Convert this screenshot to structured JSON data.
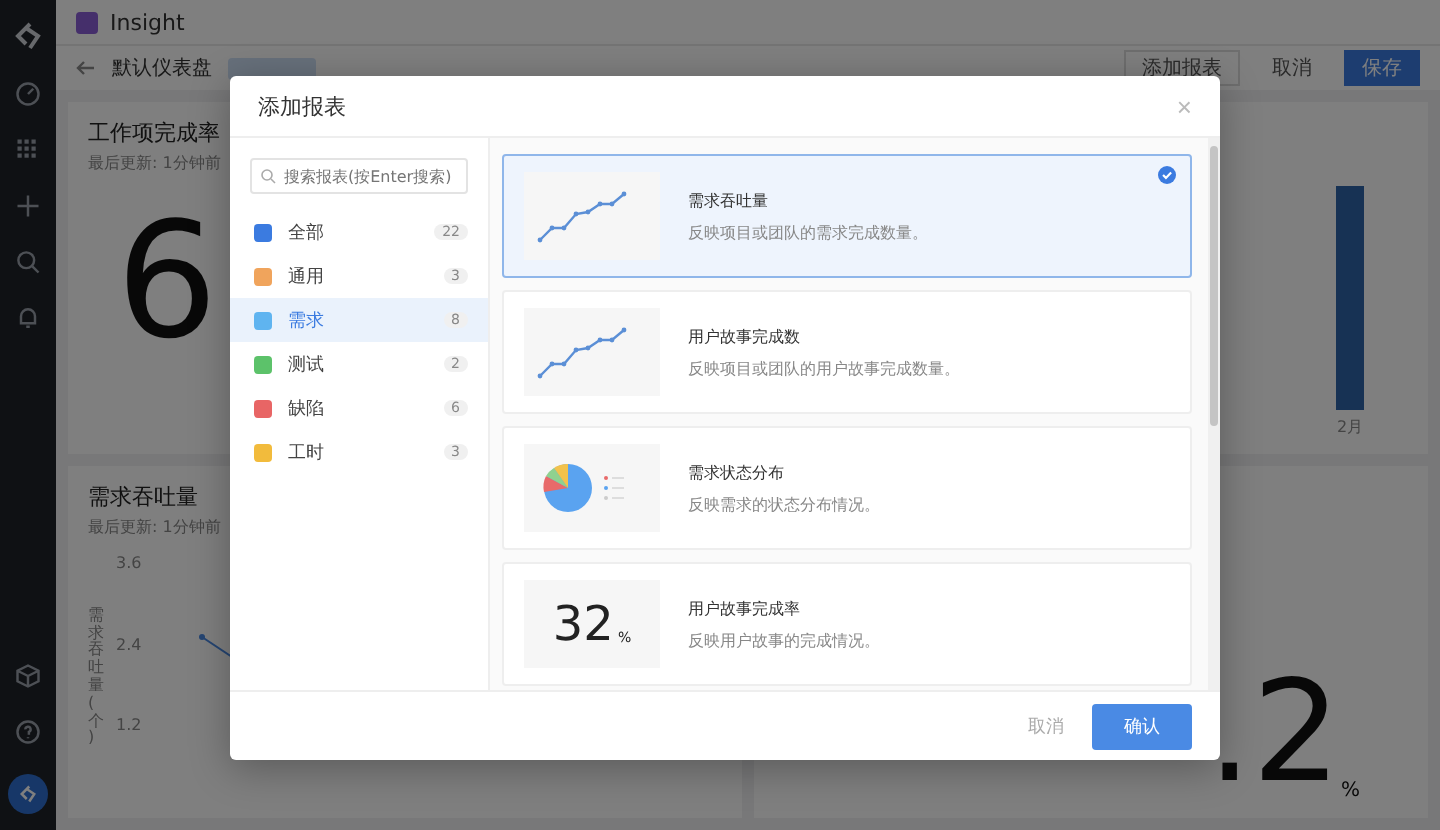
{
  "app": {
    "title": "Insight"
  },
  "toolbar": {
    "dashboard": "默认仪表盘",
    "add_button": "添加报表",
    "cancel": "取消",
    "save": "保存"
  },
  "cards": [
    {
      "kind": "number",
      "title": "工作项完成率",
      "updated": "最后更新: 1分钟前",
      "value": "6"
    },
    {
      "kind": "bar",
      "label": "2月"
    },
    {
      "kind": "line",
      "title": "需求吞吐量",
      "updated": "最后更新: 1分钟前",
      "yticks": [
        "3.6",
        "2.4",
        "1.2"
      ],
      "ylabel": "需求吞吐量(个)"
    },
    {
      "kind": "number",
      "value": ".2",
      "unit": "%"
    }
  ],
  "dialog": {
    "title": "添加报表",
    "close": "×",
    "search": {
      "placeholder": "搜索报表(按Enter搜索)"
    },
    "categories": [
      {
        "label": "全部",
        "count": "22",
        "color": "#3b7be0",
        "selected": false
      },
      {
        "label": "通用",
        "count": "3",
        "color": "#f0a45c",
        "selected": false
      },
      {
        "label": "需求",
        "count": "8",
        "color": "#5fb4f0",
        "selected": true
      },
      {
        "label": "测试",
        "count": "2",
        "color": "#5cc26a",
        "selected": false
      },
      {
        "label": "缺陷",
        "count": "6",
        "color": "#e86565",
        "selected": false
      },
      {
        "label": "工时",
        "count": "3",
        "color": "#f2bb3c",
        "selected": false
      }
    ],
    "reports": [
      {
        "kind": "line",
        "title": "需求吞吐量",
        "description": "反映项目或团队的需求完成数量。",
        "selected": true
      },
      {
        "kind": "line",
        "title": "用户故事完成数",
        "description": "反映项目或团队的用户故事完成数量。",
        "selected": false
      },
      {
        "kind": "pie",
        "title": "需求状态分布",
        "description": "反映需求的状态分布情况。",
        "selected": false
      },
      {
        "kind": "number",
        "value": "32",
        "unit": "%",
        "title": "用户故事完成率",
        "description": "反映用户故事的完成情况。",
        "selected": false
      }
    ],
    "buttons": {
      "cancel": "取消",
      "confirm": "确认"
    }
  }
}
